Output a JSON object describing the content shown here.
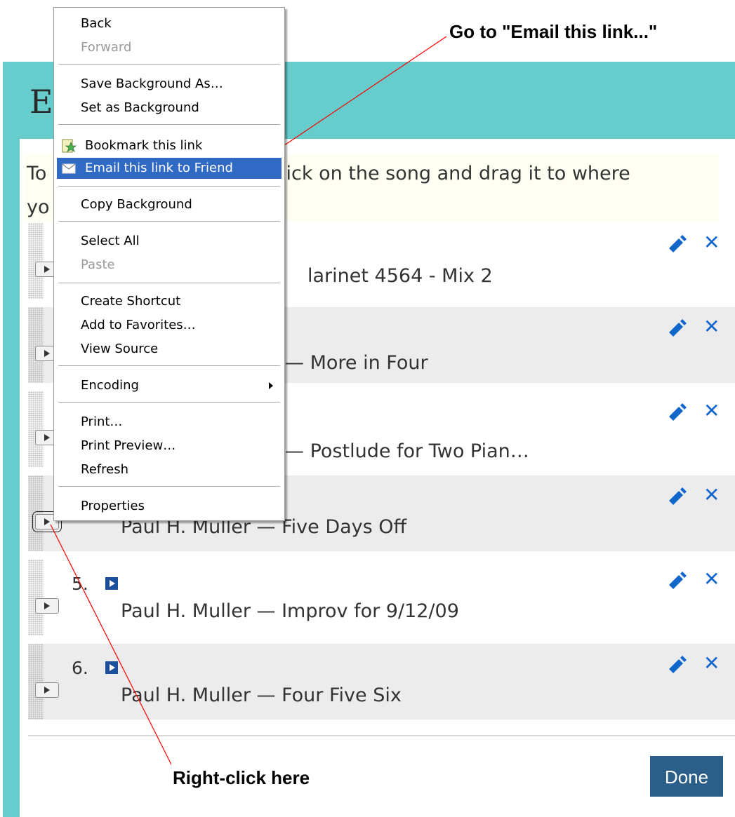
{
  "dialog": {
    "title_fragment": "E",
    "instruction_line1_left": "To",
    "instruction_line1_right": ", click on the song and drag it to where",
    "instruction_line2": "yo",
    "done_label": "Done"
  },
  "playlist": [
    {
      "number": "",
      "title": "larinet 4564 - Mix 2"
    },
    {
      "number": "",
      "title": "— More in Four"
    },
    {
      "number": "",
      "title": "— Postlude for Two Pian…"
    },
    {
      "number": "",
      "title": "Paul H. Muller — Five Days Off"
    },
    {
      "number": "5.",
      "title": "Paul H. Muller — Improv for 9/12/09"
    },
    {
      "number": "6.",
      "title": "Paul H. Muller — Four Five Six"
    }
  ],
  "context_menu": {
    "back": "Back",
    "forward": "Forward",
    "save_background": "Save Background As…",
    "set_background": "Set as Background",
    "bookmark_link": "Bookmark this link",
    "email_link": "Email this link to Friend",
    "copy_background": "Copy Background",
    "select_all": "Select All",
    "paste": "Paste",
    "create_shortcut": "Create Shortcut",
    "add_favorites": "Add to Favorites…",
    "view_source": "View Source",
    "encoding": "Encoding",
    "print": "Print…",
    "print_preview": "Print Preview…",
    "refresh": "Refresh",
    "properties": "Properties"
  },
  "annotations": {
    "top": "Go to \"Email this link...\"",
    "bottom": "Right-click here"
  },
  "colors": {
    "frame": "#66cccc",
    "menu_highlight": "#316ac5",
    "icon_blue": "#1166cc",
    "done_button": "#2b5f8a",
    "annotation_line": "#ff0000"
  }
}
